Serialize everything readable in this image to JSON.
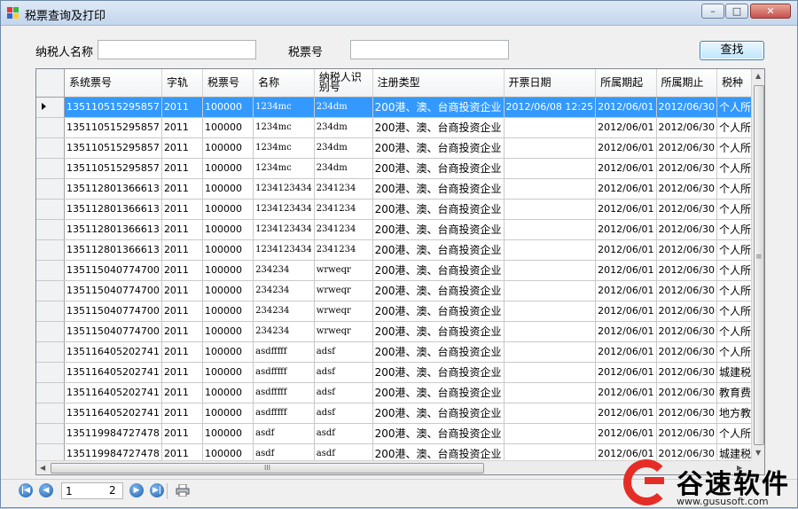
{
  "window": {
    "title": "税票查询及打印",
    "minimize": "–",
    "maximize": "□",
    "close": "✕"
  },
  "search": {
    "taxpayer_label": "纳税人名称",
    "taxpayer_value": "",
    "ticket_label": "税票号",
    "ticket_value": "",
    "query_button": "查找"
  },
  "grid": {
    "columns": [
      "系统票号",
      "字轨",
      "税票号",
      "名称",
      "纳税人识别号",
      "注册类型",
      "开票日期",
      "所属期起",
      "所属期止",
      "税种"
    ],
    "rows": [
      [
        "135110515295857",
        "2011",
        "100000",
        "1234mc",
        "234dm",
        "200港、澳、台商投资企业",
        "2012/06/08 12:25",
        "2012/06/01",
        "2012/06/30",
        "个人所得"
      ],
      [
        "135110515295857",
        "2011",
        "100000",
        "1234mc",
        "234dm",
        "200港、澳、台商投资企业",
        "",
        "2012/06/01",
        "2012/06/30",
        "个人所得"
      ],
      [
        "135110515295857",
        "2011",
        "100000",
        "1234mc",
        "234dm",
        "200港、澳、台商投资企业",
        "",
        "2012/06/01",
        "2012/06/30",
        "个人所得"
      ],
      [
        "135110515295857",
        "2011",
        "100000",
        "1234mc",
        "234dm",
        "200港、澳、台商投资企业",
        "",
        "2012/06/01",
        "2012/06/30",
        "个人所得"
      ],
      [
        "135112801366613",
        "2011",
        "100000",
        "1234123434",
        "2341234",
        "200港、澳、台商投资企业",
        "",
        "2012/06/01",
        "2012/06/30",
        "个人所得"
      ],
      [
        "135112801366613",
        "2011",
        "100000",
        "1234123434",
        "2341234",
        "200港、澳、台商投资企业",
        "",
        "2012/06/01",
        "2012/06/30",
        "个人所得"
      ],
      [
        "135112801366613",
        "2011",
        "100000",
        "1234123434",
        "2341234",
        "200港、澳、台商投资企业",
        "",
        "2012/06/01",
        "2012/06/30",
        "个人所得"
      ],
      [
        "135112801366613",
        "2011",
        "100000",
        "1234123434",
        "2341234",
        "200港、澳、台商投资企业",
        "",
        "2012/06/01",
        "2012/06/30",
        "个人所得"
      ],
      [
        "135115040774700",
        "2011",
        "100000",
        "234234",
        "wrweqr",
        "200港、澳、台商投资企业",
        "",
        "2012/06/01",
        "2012/06/30",
        "个人所得"
      ],
      [
        "135115040774700",
        "2011",
        "100000",
        "234234",
        "wrweqr",
        "200港、澳、台商投资企业",
        "",
        "2012/06/01",
        "2012/06/30",
        "个人所得"
      ],
      [
        "135115040774700",
        "2011",
        "100000",
        "234234",
        "wrweqr",
        "200港、澳、台商投资企业",
        "",
        "2012/06/01",
        "2012/06/30",
        "个人所得"
      ],
      [
        "135115040774700",
        "2011",
        "100000",
        "234234",
        "wrweqr",
        "200港、澳、台商投资企业",
        "",
        "2012/06/01",
        "2012/06/30",
        "个人所得"
      ],
      [
        "135116405202741",
        "2011",
        "100000",
        "asdfffff",
        "adsf",
        "200港、澳、台商投资企业",
        "",
        "2012/06/01",
        "2012/06/30",
        "个人所得"
      ],
      [
        "135116405202741",
        "2011",
        "100000",
        "asdfffff",
        "adsf",
        "200港、澳、台商投资企业",
        "",
        "2012/06/01",
        "2012/06/30",
        "城建税"
      ],
      [
        "135116405202741",
        "2011",
        "100000",
        "asdfffff",
        "adsf",
        "200港、澳、台商投资企业",
        "",
        "2012/06/01",
        "2012/06/30",
        "教育费附"
      ],
      [
        "135116405202741",
        "2011",
        "100000",
        "asdfffff",
        "adsf",
        "200港、澳、台商投资企业",
        "",
        "2012/06/01",
        "2012/06/30",
        "地方教育"
      ],
      [
        "135119984727478",
        "2011",
        "100000",
        "asdf",
        "asdf",
        "200港、澳、台商投资企业",
        "",
        "2012/06/01",
        "2012/06/30",
        "个人所得"
      ],
      [
        "135119984727478",
        "2011",
        "100000",
        "asdf",
        "asdf",
        "200港、澳、台商投资企业",
        "",
        "2012/06/01",
        "2012/06/30",
        "城建税"
      ]
    ],
    "h_scroll_grip": "III",
    "v_scroll_grip": "≡"
  },
  "pager": {
    "current_page": "1",
    "total_pages": "2"
  },
  "watermark": {
    "brand": "谷速软件",
    "url": "www.gususoft.com"
  },
  "colors": {
    "selection": "#3399ff",
    "logo_red": "#e52d27"
  }
}
